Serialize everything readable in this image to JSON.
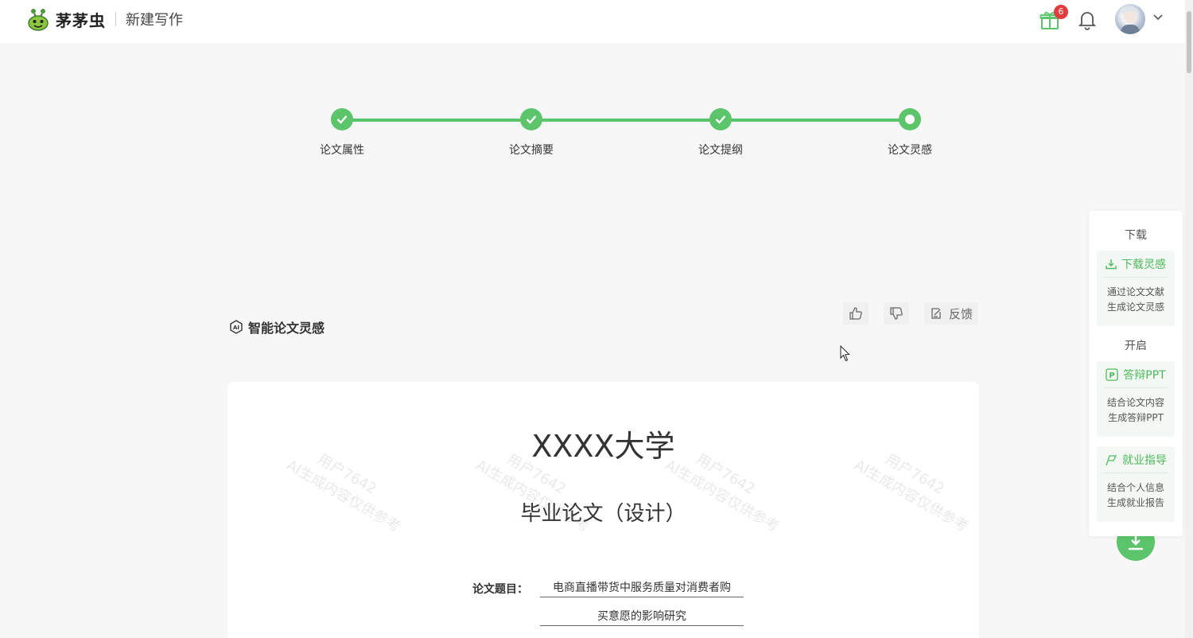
{
  "header": {
    "brand": "茅茅虫",
    "page_name": "新建写作",
    "gift_badge": "6"
  },
  "steps": [
    {
      "label": "论文属性",
      "state": "done"
    },
    {
      "label": "论文摘要",
      "state": "done"
    },
    {
      "label": "论文提纲",
      "state": "done"
    },
    {
      "label": "论文灵感",
      "state": "current"
    }
  ],
  "section": {
    "title": "智能论文灵感",
    "feedback_label": "反馈"
  },
  "document": {
    "university": "XXXX大学",
    "subtitle": "毕业论文（设计）",
    "topic_label": "论文题目：",
    "topic_line1": "电商直播带货中服务质量对消费者购",
    "topic_line2": "买意愿的影响研究",
    "watermark_user": "用户7642",
    "watermark_note": "AI生成内容仅供参考"
  },
  "side_panel": {
    "download_head": "下载",
    "download_title": "下载灵感",
    "download_desc1": "通过论文文献",
    "download_desc2": "生成论文灵感",
    "open_head": "开启",
    "ppt_title": "答辩PPT",
    "ppt_desc1": "结合论文内容",
    "ppt_desc2": "生成答辩PPT",
    "career_title": "就业指导",
    "career_desc1": "结合个人信息",
    "career_desc2": "生成就业报告"
  },
  "colors": {
    "accent": "#5cc46a",
    "badge": "#e23c3c"
  }
}
